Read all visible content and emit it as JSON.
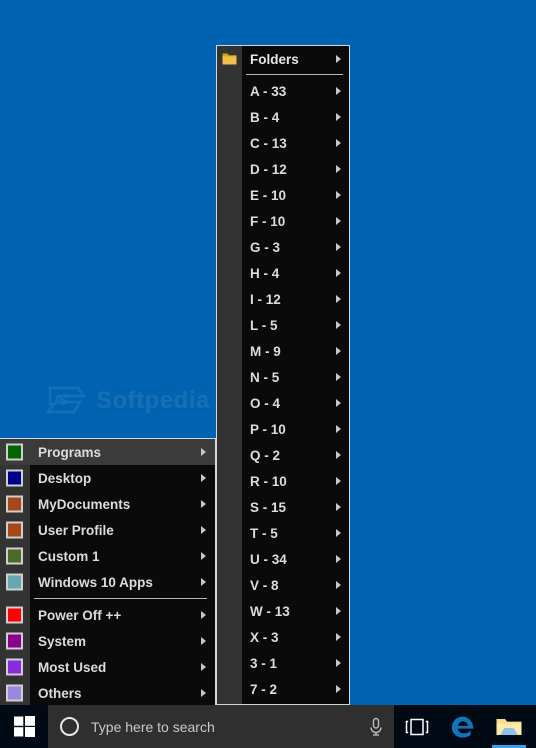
{
  "desktop": {
    "background_color": "#0063b1",
    "watermark_text": "Softpedia"
  },
  "main_menu": {
    "name": "Classic Start Menu",
    "items": [
      {
        "label": "Programs",
        "color": "#006400",
        "arrow": "submenu-arrow",
        "selected": true,
        "separator_before": false
      },
      {
        "label": "Desktop",
        "color": "#00008b",
        "arrow": "submenu-arrow",
        "selected": false,
        "separator_before": false
      },
      {
        "label": "MyDocuments",
        "color": "#a8471a",
        "arrow": "submenu-arrow",
        "selected": false,
        "separator_before": false
      },
      {
        "label": "User Profile",
        "color": "#a8471a",
        "arrow": "submenu-arrow",
        "selected": false,
        "separator_before": false
      },
      {
        "label": "Custom 1",
        "color": "#4d6b28",
        "arrow": "submenu-arrow",
        "selected": false,
        "separator_before": false
      },
      {
        "label": "Windows 10 Apps",
        "color": "#66a8ad",
        "arrow": "submenu-arrow",
        "selected": false,
        "separator_before": false
      },
      {
        "label": "Power Off ++",
        "color": "#fe0000",
        "arrow": "submenu-arrow",
        "selected": false,
        "separator_before": true
      },
      {
        "label": "System",
        "color": "#8b008b",
        "arrow": "submenu-arrow",
        "selected": false,
        "separator_before": false
      },
      {
        "label": "Most Used",
        "color": "#8a2be2",
        "arrow": "submenu-arrow",
        "selected": false,
        "separator_before": false
      },
      {
        "label": "Others",
        "color": "#9b86e0",
        "arrow": "submenu-arrow",
        "selected": false,
        "separator_before": false
      }
    ]
  },
  "folders_menu": {
    "header": {
      "label": "Folders",
      "icon": "folder-icon",
      "arrow": "submenu-arrow"
    },
    "items": [
      {
        "label": "A - 33",
        "arrow": "submenu-arrow"
      },
      {
        "label": "B - 4",
        "arrow": "submenu-arrow"
      },
      {
        "label": "C - 13",
        "arrow": "submenu-arrow"
      },
      {
        "label": "D - 12",
        "arrow": "submenu-arrow"
      },
      {
        "label": "E - 10",
        "arrow": "submenu-arrow"
      },
      {
        "label": "F - 10",
        "arrow": "submenu-arrow"
      },
      {
        "label": "G - 3",
        "arrow": "submenu-arrow"
      },
      {
        "label": "H - 4",
        "arrow": "submenu-arrow"
      },
      {
        "label": "I - 12",
        "arrow": "submenu-arrow"
      },
      {
        "label": "L - 5",
        "arrow": "submenu-arrow"
      },
      {
        "label": "M - 9",
        "arrow": "submenu-arrow"
      },
      {
        "label": "N - 5",
        "arrow": "submenu-arrow"
      },
      {
        "label": "O - 4",
        "arrow": "submenu-arrow"
      },
      {
        "label": "P - 10",
        "arrow": "submenu-arrow"
      },
      {
        "label": "Q - 2",
        "arrow": "submenu-arrow"
      },
      {
        "label": "R - 10",
        "arrow": "submenu-arrow"
      },
      {
        "label": "S - 15",
        "arrow": "submenu-arrow"
      },
      {
        "label": "T - 5",
        "arrow": "submenu-arrow"
      },
      {
        "label": "U - 34",
        "arrow": "submenu-arrow"
      },
      {
        "label": "V - 8",
        "arrow": "submenu-arrow"
      },
      {
        "label": "W - 13",
        "arrow": "submenu-arrow"
      },
      {
        "label": "X - 3",
        "arrow": "submenu-arrow"
      },
      {
        "label": "3 - 1",
        "arrow": "submenu-arrow"
      },
      {
        "label": "7 - 2",
        "arrow": "submenu-arrow"
      }
    ]
  },
  "taskbar": {
    "start_button_icon": "windows-logo-icon",
    "search": {
      "placeholder": "Type here to search",
      "cortana_icon": "cortana-ring-icon",
      "mic_icon": "microphone-icon"
    },
    "buttons": [
      {
        "name": "task-view",
        "icon": "task-view-icon",
        "active": false
      },
      {
        "name": "edge",
        "icon": "edge-icon",
        "active": false
      },
      {
        "name": "explorer",
        "icon": "file-explorer-icon",
        "active": true
      }
    ]
  }
}
